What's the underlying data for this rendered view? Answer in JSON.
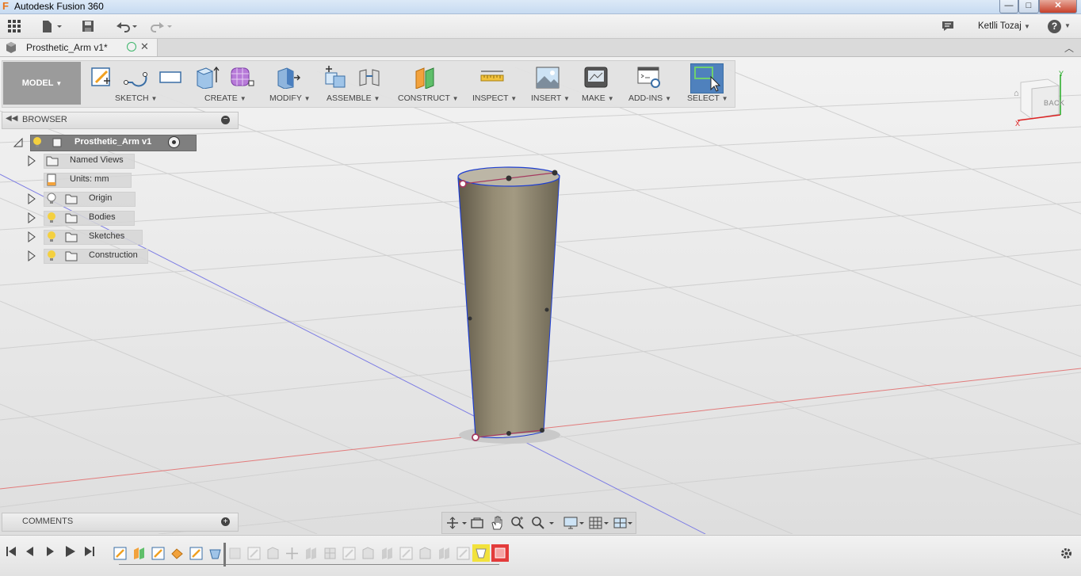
{
  "window": {
    "title": "Autodesk Fusion 360",
    "logo_letter": "F",
    "min_glyph": "—",
    "max_glyph": "□",
    "close_glyph": "✕"
  },
  "qat": {
    "user": "Ketlli Tozaj",
    "help": "?"
  },
  "doc_tab": {
    "title": "Prosthetic_Arm v1*",
    "close_glyph": "✕"
  },
  "ribbon": {
    "workspace": "MODEL",
    "groups": [
      "SKETCH",
      "CREATE",
      "MODIFY",
      "ASSEMBLE",
      "CONSTRUCT",
      "INSPECT",
      "INSERT",
      "MAKE",
      "ADD-INS",
      "SELECT"
    ]
  },
  "browser": {
    "title": "BROWSER",
    "root": "Prosthetic_Arm v1",
    "nodes": [
      "Named Views",
      "Units: mm",
      "Origin",
      "Bodies",
      "Sketches",
      "Construction"
    ]
  },
  "comments": {
    "title": "COMMENTS"
  },
  "viewcube": {
    "face": "BACK",
    "axis_x": "X",
    "axis_y": "Y"
  },
  "colors": {
    "accent": "#4a7fbf",
    "select_active": "#4f81bd",
    "body": "#8f8670",
    "sketch_line": "#1f3fd0"
  }
}
